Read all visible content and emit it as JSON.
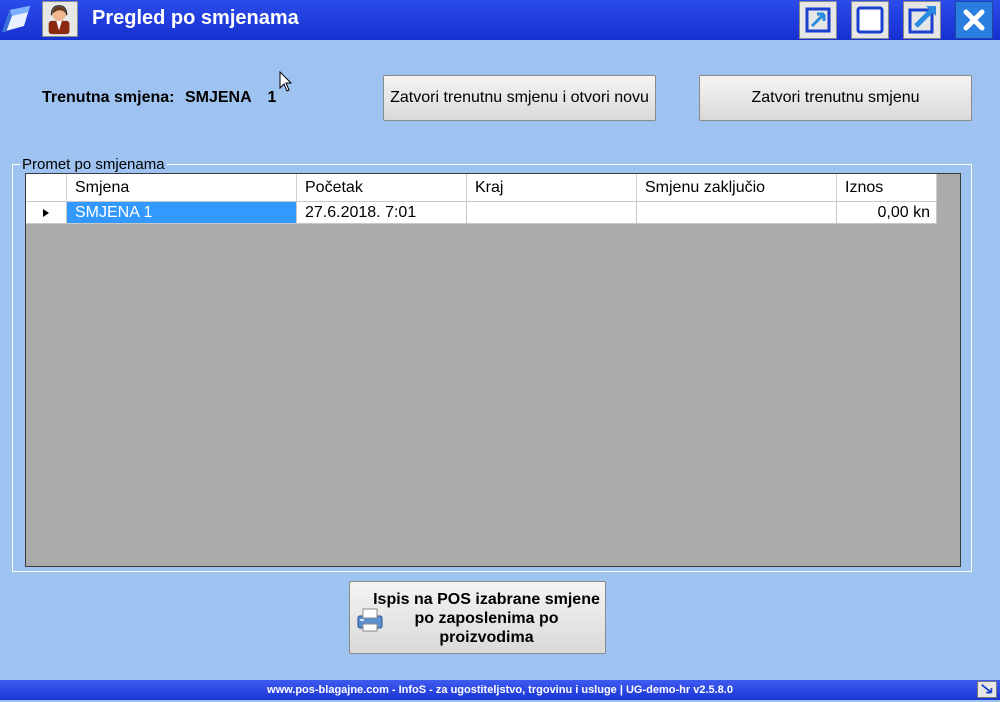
{
  "window": {
    "title": "Pregled po smjenama"
  },
  "icons": {
    "app_logo": "app-logo-icon",
    "user": "user-icon",
    "restore": "restore-icon",
    "maximize": "maximize-icon",
    "edit": "edit-icon",
    "close": "close-icon",
    "printer": "printer-icon"
  },
  "colors": {
    "titlebar": "#1f3ee0",
    "background": "#9fc3f0",
    "selection": "#3399ff",
    "close_button": "#2a7ee0"
  },
  "current_shift": {
    "label": "Trenutna smjena:",
    "value": "SMJENA",
    "number": "1"
  },
  "buttons": {
    "close_and_open": "Zatvori trenutnu smjenu i otvori novu",
    "close_current": "Zatvori trenutnu smjenu",
    "print_pos": "Ispis na POS izabrane smjene po zaposlenima po proizvodima"
  },
  "group": {
    "title": "Promet po smjenama"
  },
  "table": {
    "columns": [
      "Smjena",
      "Početak",
      "Kraj",
      "Smjenu zaključio",
      "Iznos"
    ],
    "rows": [
      {
        "smjena": "SMJENA 1",
        "pocetak": "27.6.2018. 7:01",
        "kraj": "",
        "zakljucio": "",
        "iznos": "0,00 kn"
      }
    ]
  },
  "footer": {
    "text": "www.pos-blagajne.com - InfoS - za ugostiteljstvo, trgovinu i usluge | UG-demo-hr v2.5.8.0"
  }
}
